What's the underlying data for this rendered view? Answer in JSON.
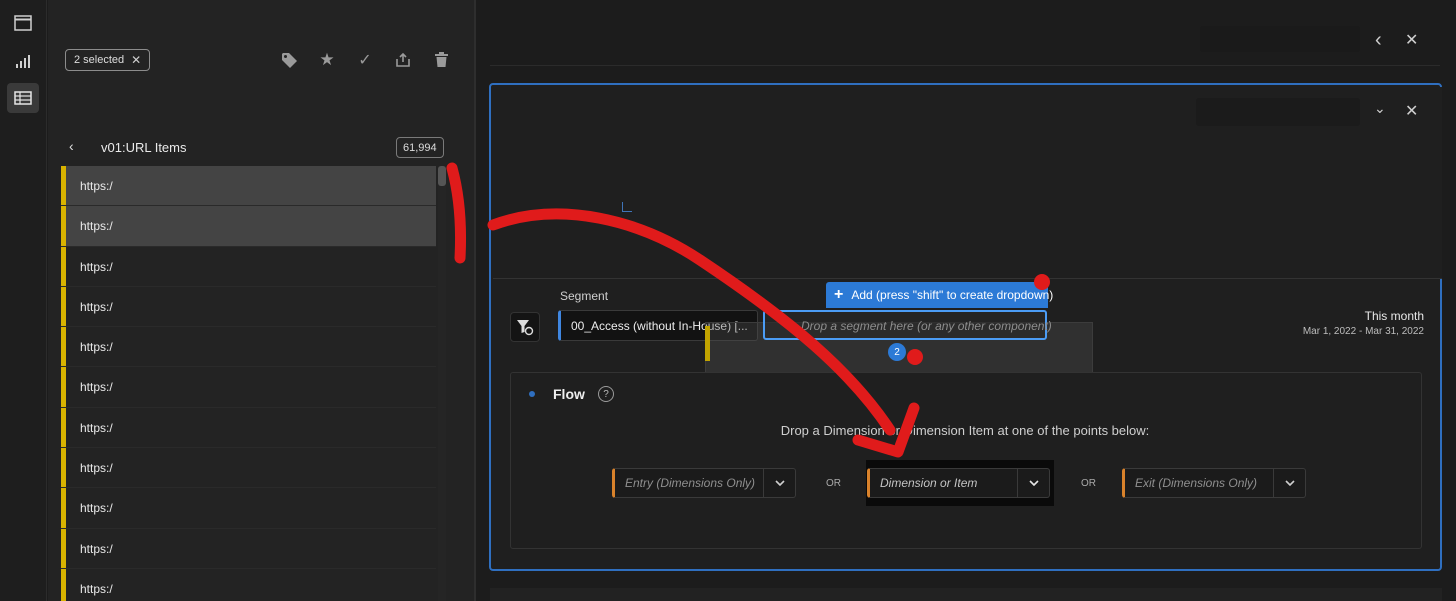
{
  "selection": {
    "chip_label": "2 selected"
  },
  "list": {
    "title": "v01:URL Items",
    "count": "61,994",
    "rows": [
      "https:/",
      "https:/",
      "https:/",
      "https:/",
      "https:/",
      "https:/",
      "https:/",
      "https:/",
      "https:/",
      "https:/",
      "https:/"
    ]
  },
  "segment": {
    "label": "Segment",
    "value": "00_Access (without In-House) [...",
    "drop_placeholder": "Drop a segment here (or any other component)",
    "add_tooltip": "Add (press \"shift\" to create dropdown)",
    "drag_count": "2"
  },
  "date": {
    "label": "This month",
    "range": "Mar 1, 2022 - Mar 31, 2022"
  },
  "flow": {
    "title": "Flow",
    "instruction": "Drop a Dimension or Dimension Item at one of the points below:",
    "entry_placeholder": "Entry (Dimensions Only)",
    "middle_placeholder": "Dimension or Item",
    "exit_placeholder": "Exit (Dimensions Only)",
    "or_label": "OR"
  },
  "colors": {
    "accent_blue": "#2f6fc0",
    "list_marker": "#d9b300",
    "dropdown_marker": "#d9822b",
    "annotation_red": "#e01b1b"
  },
  "icons": [
    "window-icon",
    "chart-icon",
    "table-icon",
    "tag-icon",
    "star-icon",
    "check-icon",
    "share-icon",
    "trash-icon",
    "back-icon",
    "chevron-left-icon",
    "close-icon",
    "chevron-down-icon",
    "filter-icon",
    "plus-icon",
    "help-icon"
  ]
}
